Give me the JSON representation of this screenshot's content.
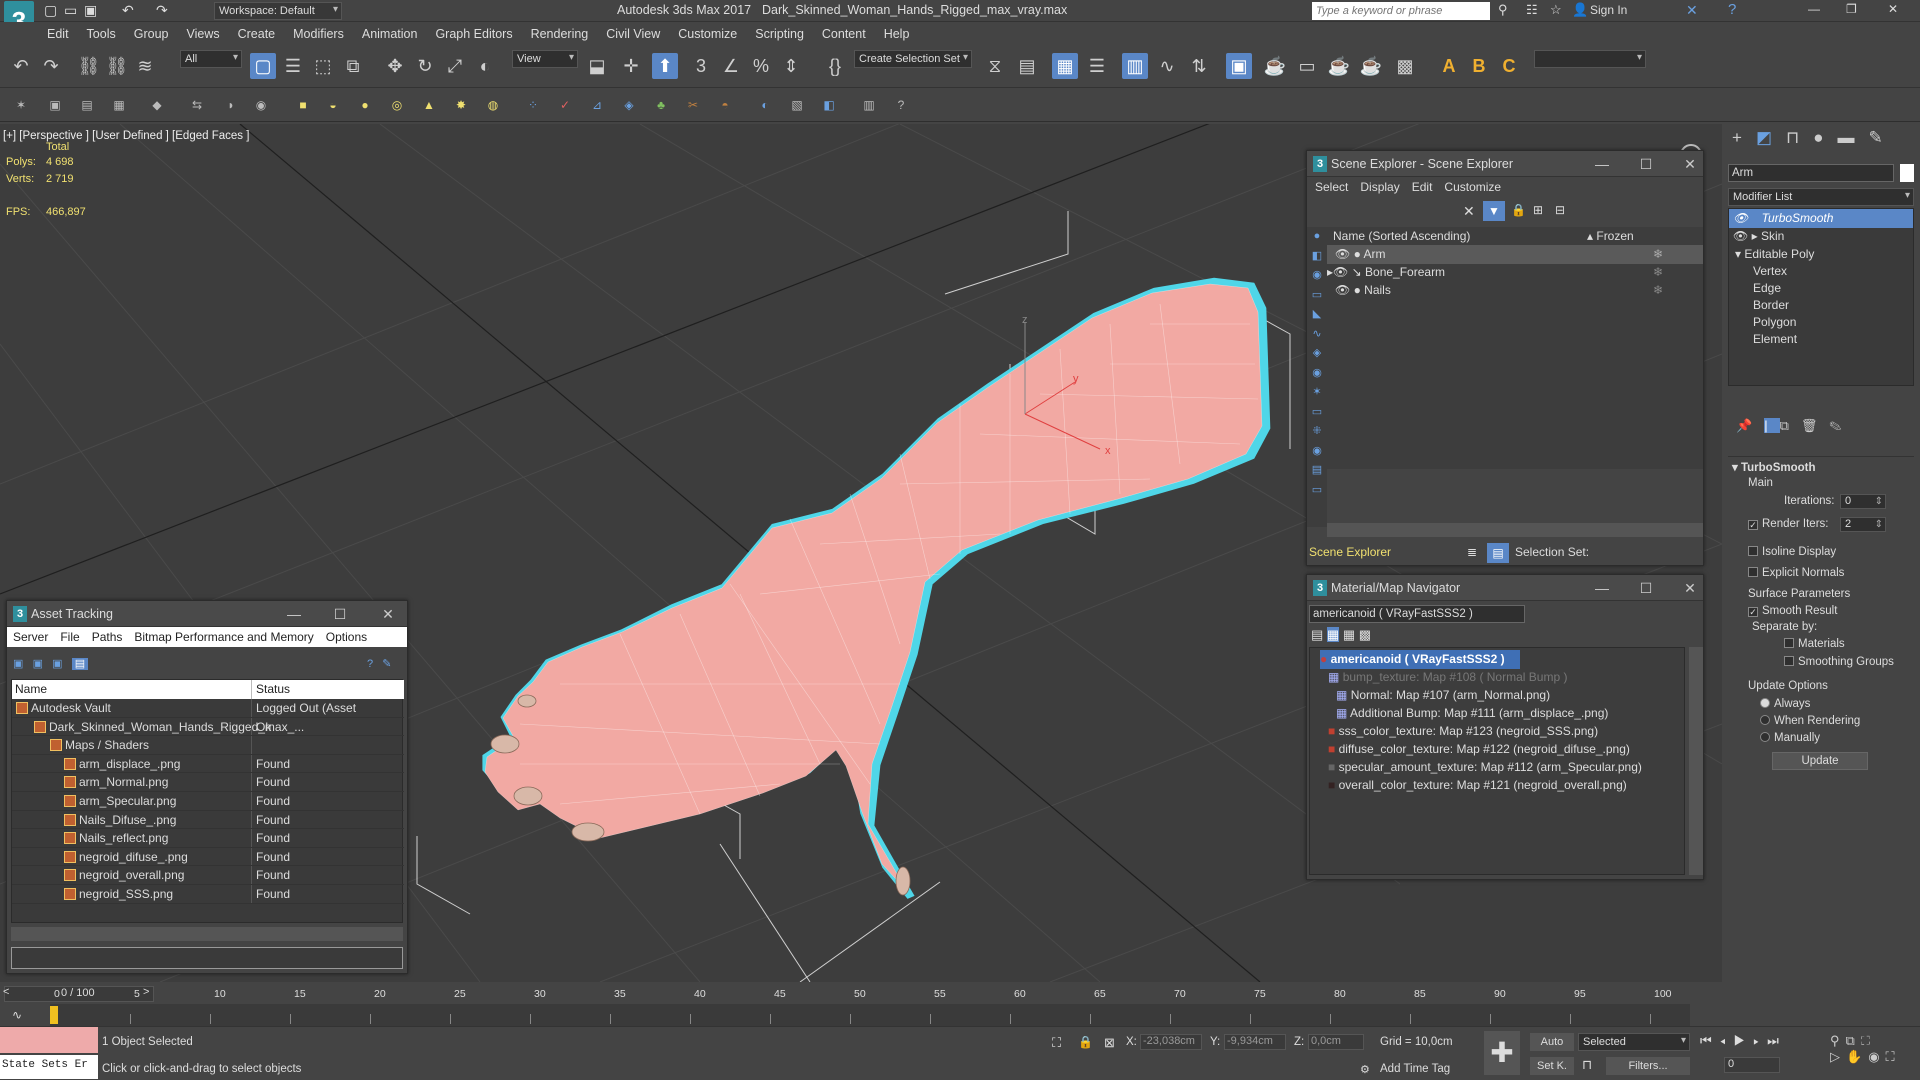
{
  "app": {
    "title": "Autodesk 3ds Max 2017",
    "file": "Dark_Skinned_Woman_Hands_Rigged_max_vray.max",
    "workspace": "Workspace: Default",
    "search_placeholder": "Type a keyword or phrase",
    "sign_in": "Sign In",
    "logo": "3"
  },
  "menu": [
    "Edit",
    "Tools",
    "Group",
    "Views",
    "Create",
    "Modifiers",
    "Animation",
    "Graph Editors",
    "Rendering",
    "Civil View",
    "Customize",
    "Scripting",
    "Content",
    "Help"
  ],
  "toolbar": {
    "filter": "All",
    "view": "View",
    "selection_set": "Create Selection Set"
  },
  "viewport": {
    "label": "[+] [Perspective ] [User Defined ] [Edged Faces ]",
    "total": "Total",
    "polys_label": "Polys:",
    "polys": "4 698",
    "verts_label": "Verts:",
    "verts": "2 719",
    "fps_label": "FPS:",
    "fps": "466,897",
    "axis_x": "x",
    "axis_y": "y",
    "axis_z": "z"
  },
  "scene_explorer": {
    "title": "Scene Explorer - Scene Explorer",
    "menu": [
      "Select",
      "Display",
      "Edit",
      "Customize"
    ],
    "col_name": "Name (Sorted Ascending)",
    "col_frozen": "▴ Frozen",
    "items": [
      "Arm",
      "Bone_Forearm",
      "Nails"
    ],
    "footer_name": "Scene Explorer",
    "selection_set": "Selection Set:"
  },
  "material_nav": {
    "title": "Material/Map Navigator",
    "current": "americanoid  ( VRayFastSSS2 )",
    "root": "americanoid  ( VRayFastSSS2 )",
    "items": [
      "bump_texture: Map #108  ( Normal Bump )",
      "Normal: Map #107 (arm_Normal.png)",
      "Additional Bump: Map #111 (arm_displace_.png)",
      "sss_color_texture: Map #123 (negroid_SSS.png)",
      "diffuse_color_texture: Map #122 (negroid_difuse_.png)",
      "specular_amount_texture: Map #112 (arm_Specular.png)",
      "overall_color_texture: Map #121 (negroid_overall.png)"
    ]
  },
  "asset_tracking": {
    "title": "Asset Tracking",
    "menu": [
      "Server",
      "File",
      "Paths",
      "Bitmap Performance and Memory",
      "Options"
    ],
    "col_name": "Name",
    "col_status": "Status",
    "rows": [
      {
        "name": "Autodesk Vault",
        "status": "Logged Out (Asset"
      },
      {
        "name": "Dark_Skinned_Woman_Hands_Rigged_max_...",
        "status": "Ok"
      },
      {
        "name": "Maps / Shaders",
        "status": ""
      },
      {
        "name": "arm_displace_.png",
        "status": "Found"
      },
      {
        "name": "arm_Normal.png",
        "status": "Found"
      },
      {
        "name": "arm_Specular.png",
        "status": "Found"
      },
      {
        "name": "Nails_Difuse_.png",
        "status": "Found"
      },
      {
        "name": "Nails_reflect.png",
        "status": "Found"
      },
      {
        "name": "negroid_difuse_.png",
        "status": "Found"
      },
      {
        "name": "negroid_overall.png",
        "status": "Found"
      },
      {
        "name": "negroid_SSS.png",
        "status": "Found"
      }
    ]
  },
  "modifier_panel": {
    "object_name": "Arm",
    "modifier_list": "Modifier List",
    "stack": [
      "TurboSmooth",
      "Skin",
      "Editable Poly",
      "Vertex",
      "Edge",
      "Border",
      "Polygon",
      "Element"
    ],
    "rollout": "TurboSmooth",
    "main": "Main",
    "iterations_label": "Iterations:",
    "iterations": "0",
    "render_iters_label": "Render Iters:",
    "render_iters": "2",
    "isoline": "Isoline Display",
    "explicit_normals": "Explicit Normals",
    "surface_params": "Surface Parameters",
    "smooth_result": "Smooth Result",
    "separate_by": "Separate by:",
    "materials": "Materials",
    "smoothing_groups": "Smoothing Groups",
    "update_options": "Update Options",
    "always": "Always",
    "when_rendering": "When Rendering",
    "manually": "Manually",
    "update": "Update"
  },
  "timeline": {
    "frame": "0 / 100",
    "ticks": [
      "0",
      "5",
      "10",
      "15",
      "20",
      "25",
      "30",
      "35",
      "40",
      "45",
      "50",
      "55",
      "60",
      "65",
      "70",
      "75",
      "80",
      "85",
      "90",
      "95",
      "100"
    ]
  },
  "status": {
    "selected": "1 Object Selected",
    "prompt": "Click or click-and-drag to select objects",
    "state_sets": "State Sets Er",
    "x_label": "X:",
    "x": "-23,038cm",
    "y_label": "Y:",
    "y": "-9,934cm",
    "z_label": "Z:",
    "z": "0,0cm",
    "grid": "Grid = 10,0cm",
    "add_time_tag": "Add Time Tag",
    "auto": "Auto",
    "set_k": "Set K.",
    "selected_dd": "Selected",
    "filters": "Filters...",
    "frame_field": "0"
  },
  "colors": {
    "accent": "#5a87c7",
    "selection": "#4fd6e8",
    "skin": "#f2a9a3"
  }
}
